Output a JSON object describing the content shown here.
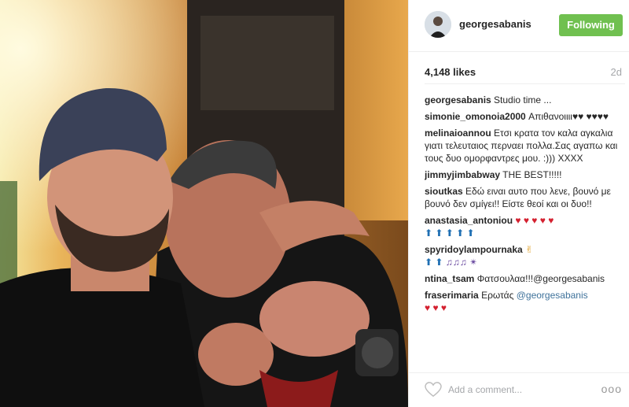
{
  "post": {
    "username": "georgesabanis",
    "follow_label": "Following",
    "likes": "4,148 likes",
    "age": "2d"
  },
  "comments": [
    {
      "user": "georgesabanis",
      "text": "Studio time ..."
    },
    {
      "user": "simonie_omonoia2000",
      "text": "Απιθανοιιιι"
    },
    {
      "user": "melinaioannou",
      "text": "Ετσι κρατα τον καλα αγκαλια γιατι τελευταιος περναει πολλα.Σας αγαπω και τους δυο ομορφαντρες μου. :))) XXXX"
    },
    {
      "user": "jimmyjimbabway",
      "text": "THE BEST!!!!!"
    },
    {
      "user": "sioutkas",
      "text": "Εδώ ειναι αυτο που λενε, βουνό με βουνό δεν σμίγει!! Είστε θεοί και οι δυο!!"
    },
    {
      "user": "anastasia_antoniou",
      "text": ""
    },
    {
      "user": "spyridoylampournaka",
      "text": ""
    },
    {
      "user": "ntina_tsam",
      "text": "Φατσουλαα!!!",
      "mention": "@georgesabanis"
    },
    {
      "user": "fraserimaria",
      "text": "Ερωτάς ",
      "mention": "@georgesabanis"
    }
  ],
  "footer": {
    "add_comment_placeholder": "Add a comment...",
    "more_label": "ooo"
  },
  "icons": {
    "like": "heart-outline-icon",
    "more": "more-options-icon",
    "top": "top-arrow-emoji",
    "music": "music-note-emoji"
  },
  "colors": {
    "follow_button": "#70c050",
    "mention": "#3f729b",
    "heart": "#d4202f",
    "muted": "#a5a7aa"
  }
}
